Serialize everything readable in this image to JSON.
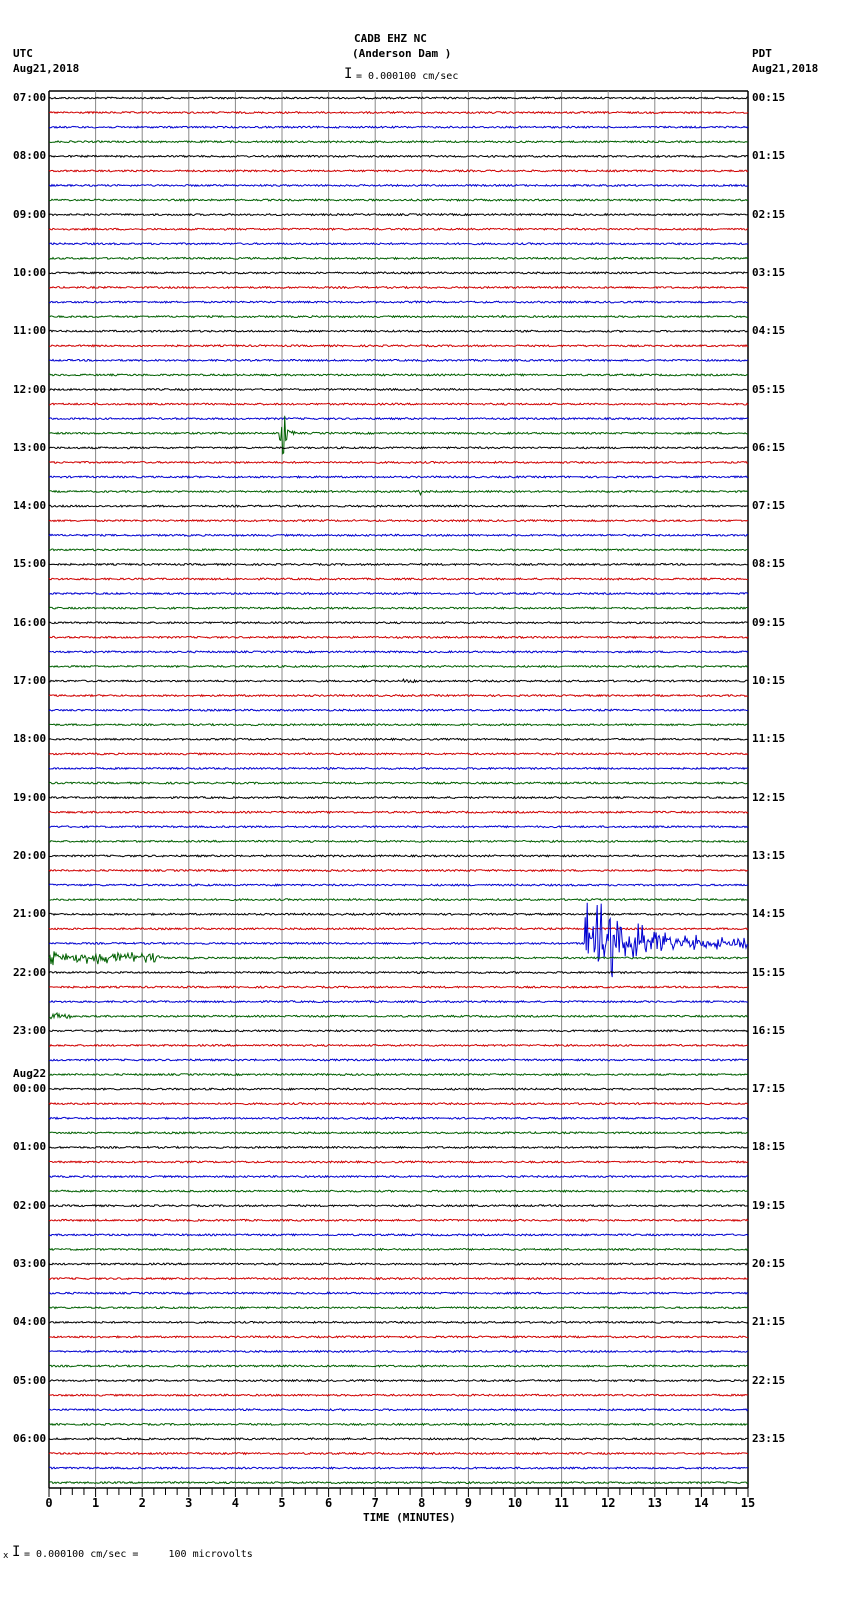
{
  "header": {
    "station": "CADB EHZ NC",
    "location": "(Anderson Dam )",
    "left_tz": "UTC",
    "left_date": "Aug21,2018",
    "right_tz": "PDT",
    "right_date": "Aug21,2018",
    "scale": "= 0.000100 cm/sec"
  },
  "footer": {
    "scale": "= 0.000100 cm/sec =     100 microvolts",
    "mark": "x"
  },
  "chart_data": {
    "type": "line",
    "title": "CADB EHZ NC (Anderson Dam )",
    "xlabel": "TIME (MINUTES)",
    "xlim": [
      0,
      15
    ],
    "x_ticks": [
      "0",
      "1",
      "2",
      "3",
      "4",
      "5",
      "6",
      "7",
      "8",
      "9",
      "10",
      "11",
      "12",
      "13",
      "14",
      "15"
    ],
    "grid": true,
    "trace_colors": [
      "#000000",
      "#d00000",
      "#0000d0",
      "#006000"
    ],
    "traces_per_hour": 4,
    "left_labels": [
      "07:00",
      "08:00",
      "09:00",
      "10:00",
      "11:00",
      "12:00",
      "13:00",
      "14:00",
      "15:00",
      "16:00",
      "17:00",
      "18:00",
      "19:00",
      "20:00",
      "21:00",
      "22:00",
      "23:00",
      "00:00",
      "01:00",
      "02:00",
      "03:00",
      "04:00",
      "05:00",
      "06:00"
    ],
    "left_date_change": {
      "index": 17,
      "label": "Aug22"
    },
    "right_labels": [
      "00:15",
      "01:15",
      "02:15",
      "03:15",
      "04:15",
      "05:15",
      "06:15",
      "07:15",
      "08:15",
      "09:15",
      "10:15",
      "11:15",
      "12:15",
      "13:15",
      "14:15",
      "15:15",
      "16:15",
      "17:15",
      "18:15",
      "19:15",
      "20:15",
      "21:15",
      "22:15",
      "23:15"
    ],
    "events": [
      {
        "trace": 23,
        "start_min": 4.95,
        "duration_min": 0.5,
        "amplitude": 50,
        "decay": 0.08
      },
      {
        "trace": 40,
        "start_min": 7.55,
        "duration_min": 0.4,
        "amplitude": 4,
        "decay": 0.3
      },
      {
        "trace": 27,
        "start_min": 7.9,
        "duration_min": 0.1,
        "amplitude": 4,
        "decay": 0.05
      },
      {
        "trace": 58,
        "start_min": 11.5,
        "duration_min": 3.5,
        "amplitude": 55,
        "decay": 0.9
      },
      {
        "trace": 59,
        "start_min": 0.0,
        "duration_min": 2.5,
        "amplitude": 3,
        "decay": 2.0
      },
      {
        "trace": 63,
        "start_min": 0.0,
        "duration_min": 0.8,
        "amplitude": 7,
        "decay": 0.3
      }
    ]
  }
}
